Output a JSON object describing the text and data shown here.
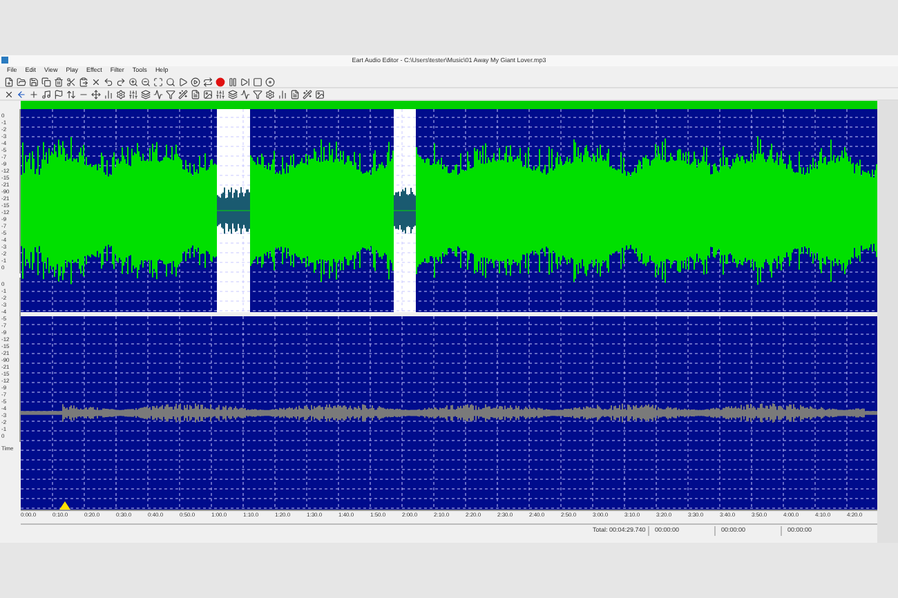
{
  "window": {
    "title": "Eart Audio Editor - C:\\Users\\tester\\Music\\01 Away My Giant Lover.mp3"
  },
  "menu": [
    "File",
    "Edit",
    "View",
    "Play",
    "Effect",
    "Filter",
    "Tools",
    "Help"
  ],
  "channels": [
    {
      "axis_labels": [
        "0",
        "-1",
        "-2",
        "-3",
        "-4",
        "-5",
        "-7",
        "-9",
        "-12",
        "-15",
        "-21",
        "-90",
        "-21",
        "-15",
        "-12",
        "-9",
        "-7",
        "-5",
        "-4",
        "-3",
        "-2",
        "-1",
        "0"
      ]
    },
    {
      "axis_labels": [
        "0",
        "-1",
        "-2",
        "-3",
        "-4",
        "-5",
        "-7",
        "-9",
        "-12",
        "-15",
        "-21",
        "-90",
        "-21",
        "-15",
        "-12",
        "-9",
        "-7",
        "-5",
        "-4",
        "-3",
        "-2",
        "-1",
        "0"
      ]
    }
  ],
  "ruler": {
    "label": "Time",
    "ticks": [
      "0:00.0",
      "0:10.0",
      "0:20.0",
      "0:30.0",
      "0:40.0",
      "0:50.0",
      "1:00.0",
      "1:10.0",
      "1:20.0",
      "1:30.0",
      "1:40.0",
      "1:50.0",
      "2:00.0",
      "2:10.0",
      "2:20.0",
      "2:30.0",
      "2:40.0",
      "2:50.0",
      "3:00.0",
      "3:10.0",
      "3:20.0",
      "3:30.0",
      "3:40.0",
      "3:50.0",
      "4:00.0",
      "4:10.0",
      "4:20.0"
    ]
  },
  "status_bar": {
    "total": "Total: 00:04:29.740",
    "fields": [
      "00:00:00",
      "00:00:00",
      "00:00:00"
    ]
  }
}
